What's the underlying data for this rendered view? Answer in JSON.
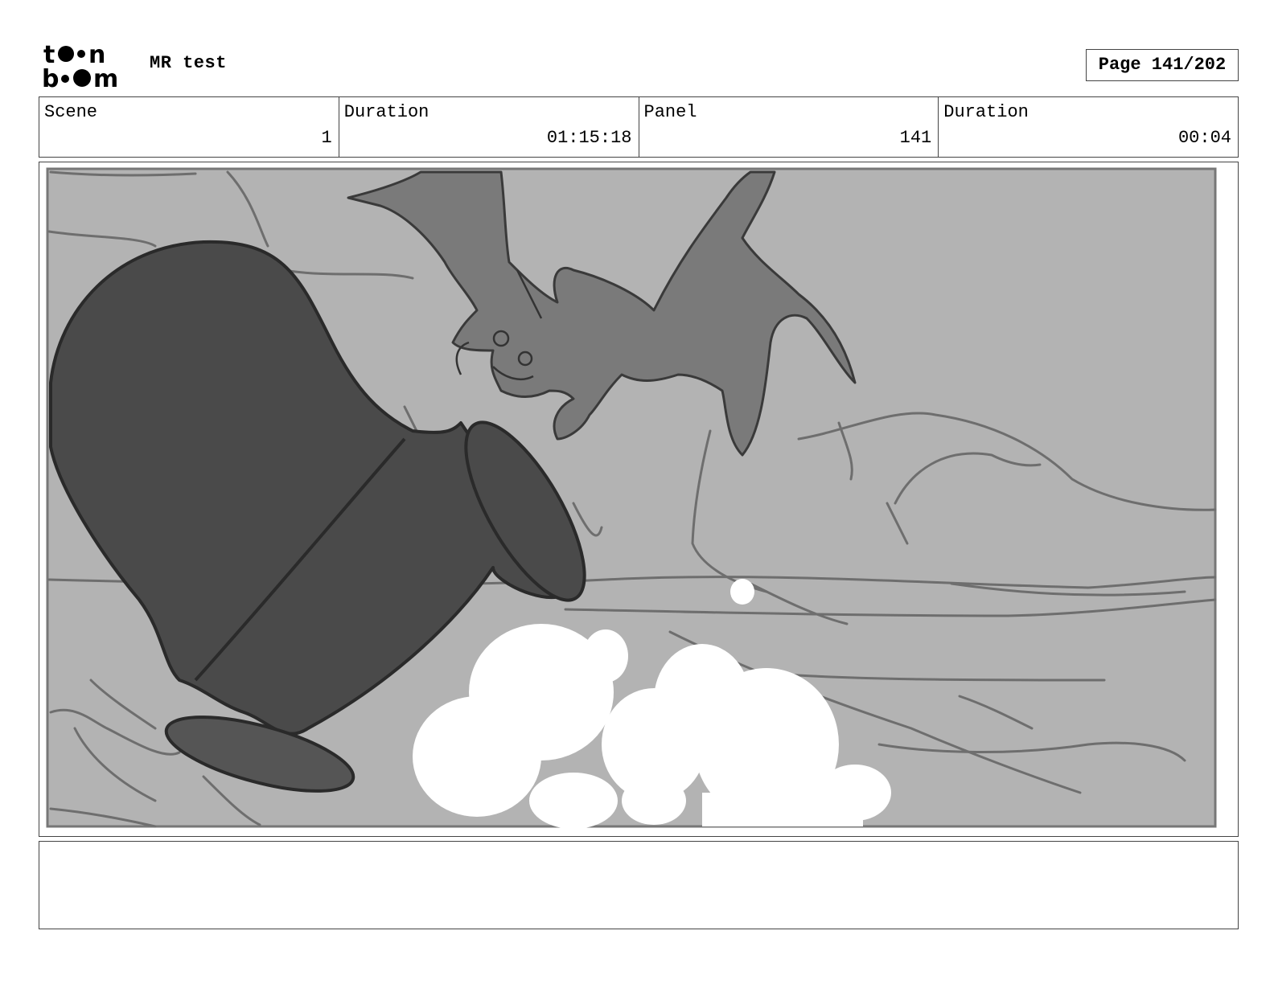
{
  "header": {
    "logo_text_top": "toon",
    "logo_text_bottom": "boom",
    "project_title": "MR test",
    "page_indicator": "Page 141/202"
  },
  "info_bar": [
    {
      "label": "Scene",
      "value": "1"
    },
    {
      "label": "Duration",
      "value": "01:15:18"
    },
    {
      "label": "Panel",
      "value": "141"
    },
    {
      "label": "Duration",
      "value": "00:04"
    }
  ],
  "panel": {
    "image_name": "storyboard-sketch-bat-over-tipped-bucket",
    "background_color": "#b3b3b3",
    "fill_dark_color": "#4a4a4a",
    "fill_mid_color": "#7a7a7a",
    "cloud_color": "#ffffff"
  },
  "notes": {
    "text": ""
  }
}
